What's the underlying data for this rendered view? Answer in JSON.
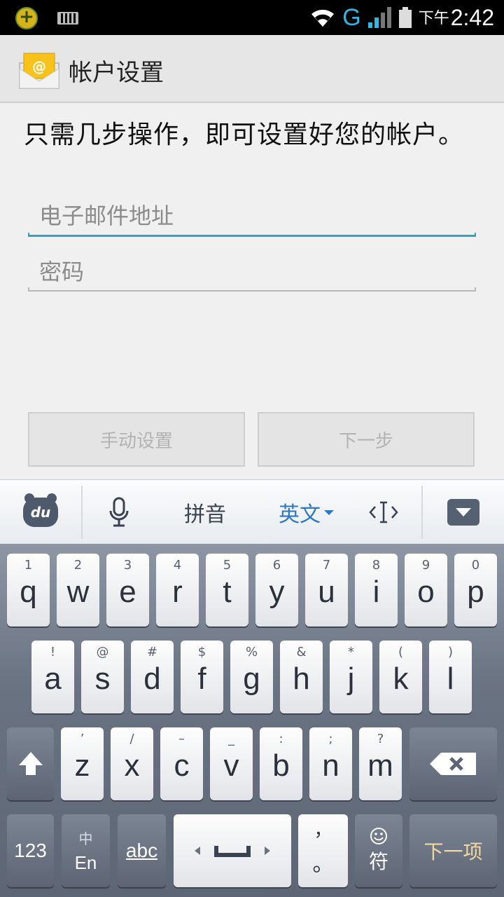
{
  "status_bar": {
    "network_type": "G",
    "time_prefix": "下午",
    "time": "2:42",
    "icons": [
      "app-notification-icon",
      "keyboard-icon",
      "wifi-icon",
      "signal-icon",
      "battery-icon"
    ]
  },
  "action_bar": {
    "title": "帐户设置",
    "icon": "email-app-icon"
  },
  "form": {
    "intro": "只需几步操作，即可设置好您的帐户。",
    "email_placeholder": "电子邮件地址",
    "password_placeholder": "密码",
    "manual_button": "手动设置",
    "next_button": "下一步"
  },
  "ime_toolbar": {
    "pinyin": "拼音",
    "english": "英文"
  },
  "keyboard": {
    "row1": [
      {
        "sub": "1",
        "main": "q"
      },
      {
        "sub": "2",
        "main": "w"
      },
      {
        "sub": "3",
        "main": "e"
      },
      {
        "sub": "4",
        "main": "r"
      },
      {
        "sub": "5",
        "main": "t"
      },
      {
        "sub": "6",
        "main": "y"
      },
      {
        "sub": "7",
        "main": "u"
      },
      {
        "sub": "8",
        "main": "i"
      },
      {
        "sub": "9",
        "main": "o"
      },
      {
        "sub": "0",
        "main": "p"
      }
    ],
    "row2": [
      {
        "sub": "!",
        "main": "a"
      },
      {
        "sub": "@",
        "main": "s"
      },
      {
        "sub": "#",
        "main": "d"
      },
      {
        "sub": "$",
        "main": "f"
      },
      {
        "sub": "%",
        "main": "g"
      },
      {
        "sub": "&",
        "main": "h"
      },
      {
        "sub": "*",
        "main": "j"
      },
      {
        "sub": "(",
        "main": "k"
      },
      {
        "sub": ")",
        "main": "l"
      }
    ],
    "row3": [
      {
        "sub": "’",
        "main": "z"
      },
      {
        "sub": "/",
        "main": "x"
      },
      {
        "sub": "–",
        "main": "c"
      },
      {
        "sub": "_",
        "main": "v"
      },
      {
        "sub": ":",
        "main": "b"
      },
      {
        "sub": ";",
        "main": "n"
      },
      {
        "sub": "?",
        "main": "m"
      }
    ],
    "num_key": "123",
    "lang_top": "中",
    "lang_bottom": "En",
    "abc_key": "abc",
    "punct_top": "，",
    "punct_bottom": "。",
    "symbol_key": "符",
    "enter_key": "下一项"
  }
}
